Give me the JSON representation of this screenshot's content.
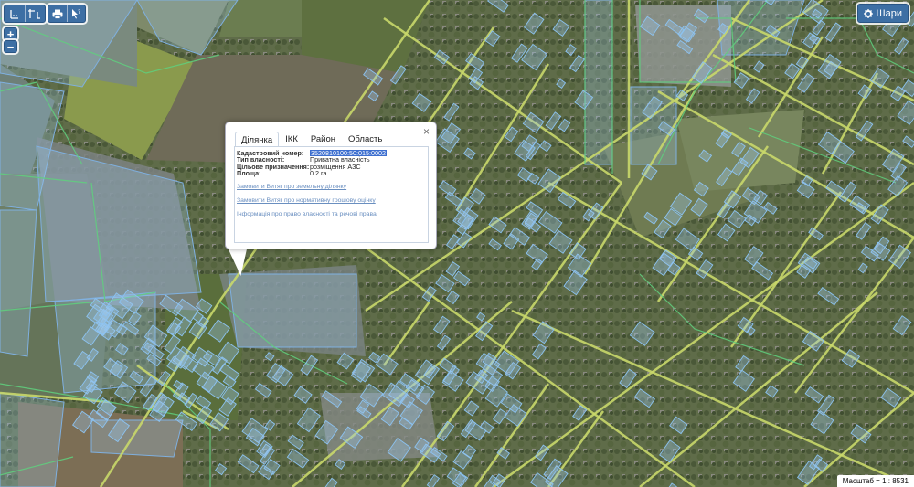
{
  "toolbar": {
    "buttons": [
      {
        "icon": "measure-length-icon"
      },
      {
        "icon": "measure-area-icon"
      },
      {
        "icon": "print-icon"
      },
      {
        "icon": "identify-pointer-icon"
      }
    ],
    "zoom_in": "+",
    "zoom_out": "−",
    "layers_label": "Шари",
    "layers_icon": "gear-icon"
  },
  "popup": {
    "close": "×",
    "tabs": [
      {
        "label": "Ділянка",
        "active": true
      },
      {
        "label": "ІКК",
        "active": false
      },
      {
        "label": "Район",
        "active": false
      },
      {
        "label": "Область",
        "active": false
      }
    ],
    "attributes": [
      {
        "key": "Кадастровий номер:",
        "value": "3520810100:50:015:0002",
        "selected": true
      },
      {
        "key": "Тип власності:",
        "value": "Приватна власність",
        "selected": false
      },
      {
        "key": "Цільове призначення:",
        "value": "розміщення АЗС",
        "selected": false
      },
      {
        "key": "Площа:",
        "value": "0.2 га",
        "selected": false
      }
    ],
    "links": [
      "Замовити Витяг про земельну ділянку",
      "Замовити Витяг про нормативну грошову оцінку",
      "Інформація про право власності та речові права"
    ]
  },
  "scale": "Масштаб = 1 : 8531",
  "colors": {
    "button_blue": "#3d6fa4",
    "parcel_fill": "#9fc8ee",
    "parcel_stroke": "#7fb0e0",
    "road_yellow": "#c9d86a",
    "link_blue": "#6a8fc0"
  }
}
